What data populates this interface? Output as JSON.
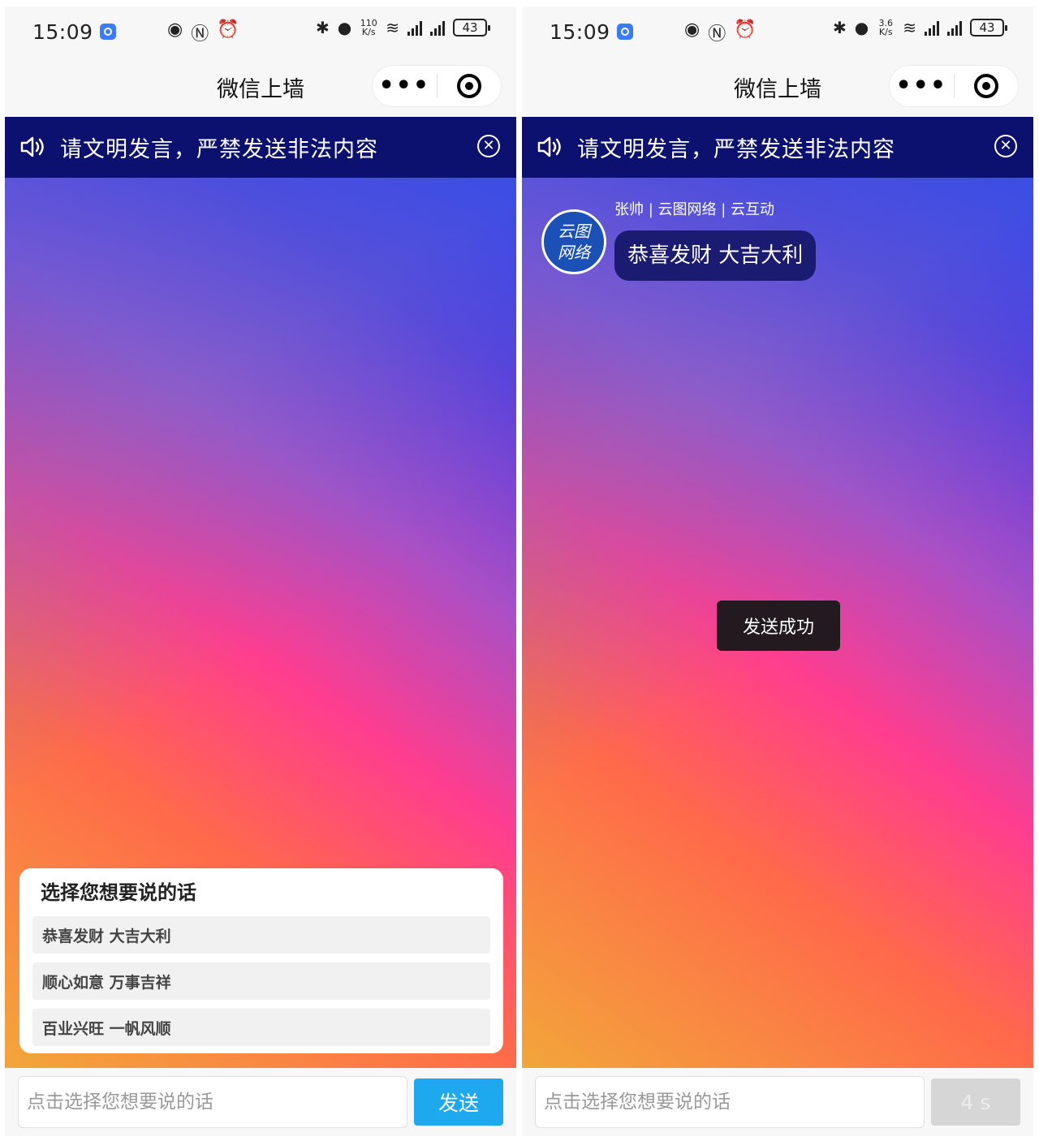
{
  "status_bar": {
    "time": "15:09",
    "speed_left": "110 K/s",
    "speed_right": "3.6 K/s",
    "battery": "43"
  },
  "nav": {
    "title": "微信上墙",
    "more_glyph": "•••"
  },
  "notice": {
    "text": "请文明发言，严禁发送非法内容",
    "close_glyph": "✕"
  },
  "phrase_panel": {
    "title": "选择您想要说的话",
    "items": [
      {
        "label": "恭喜发财 大吉大利"
      },
      {
        "label": "顺心如意 万事吉祥"
      },
      {
        "label": "百业兴旺 一帆风顺"
      }
    ]
  },
  "chat": {
    "sender": "张帅 | 云图网络 | 云互动",
    "message": "恭喜发财 大吉大利",
    "avatar_line1": "云图",
    "avatar_line2": "网络"
  },
  "toast": {
    "text": "发送成功"
  },
  "input": {
    "placeholder": "点击选择您想要说的话"
  },
  "buttons": {
    "send_label": "发送",
    "countdown_label": "4 s"
  },
  "colors": {
    "notice_bg": "#0c1170",
    "send_button": "#1ea8ee",
    "bubble_bg": "#1c1b72",
    "avatar_bg": "#1b50b6"
  },
  "icons": [
    "app-icon",
    "eye-icon",
    "nfc-icon",
    "alarm-icon",
    "bluetooth-icon",
    "location-icon",
    "wifi-icon",
    "signal-icon",
    "battery-icon",
    "more-icon",
    "target-icon",
    "speaker-icon",
    "close-circle-icon"
  ]
}
